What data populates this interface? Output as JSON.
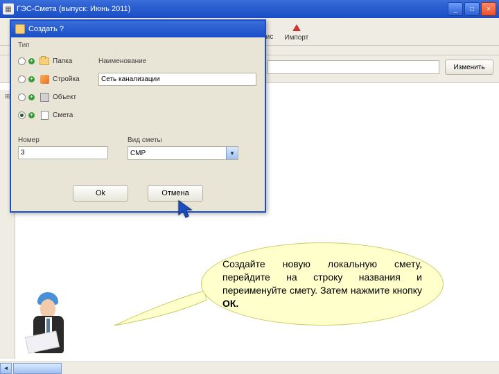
{
  "window": {
    "title": "ГЭС-Смета (выпуск: Июнь 2011)",
    "min": "_",
    "max": "□",
    "close": "×"
  },
  "toolbar": {
    "service": "Сервис",
    "import": "Импорт"
  },
  "buttons": {
    "change": "Изменить"
  },
  "dialog": {
    "title": "Создать ?",
    "group": "Тип",
    "types": {
      "folder": "Папка",
      "construction": "Стройка",
      "object": "Объект",
      "smeta": "Смета"
    },
    "name_label": "Наименование",
    "name_value": "Сеть канализации",
    "number_label": "Номер",
    "number_value": "3",
    "kind_label": "Вид сметы",
    "kind_value": "СМР",
    "ok": "Ok",
    "cancel": "Отмена"
  },
  "hint": {
    "line1": "Создайте новую локальную смету, перейдите на строку названия и переименуйте смету. Затем нажмите кнопку ",
    "bold": "ОК."
  },
  "tree": {
    "expand": "⊞"
  }
}
